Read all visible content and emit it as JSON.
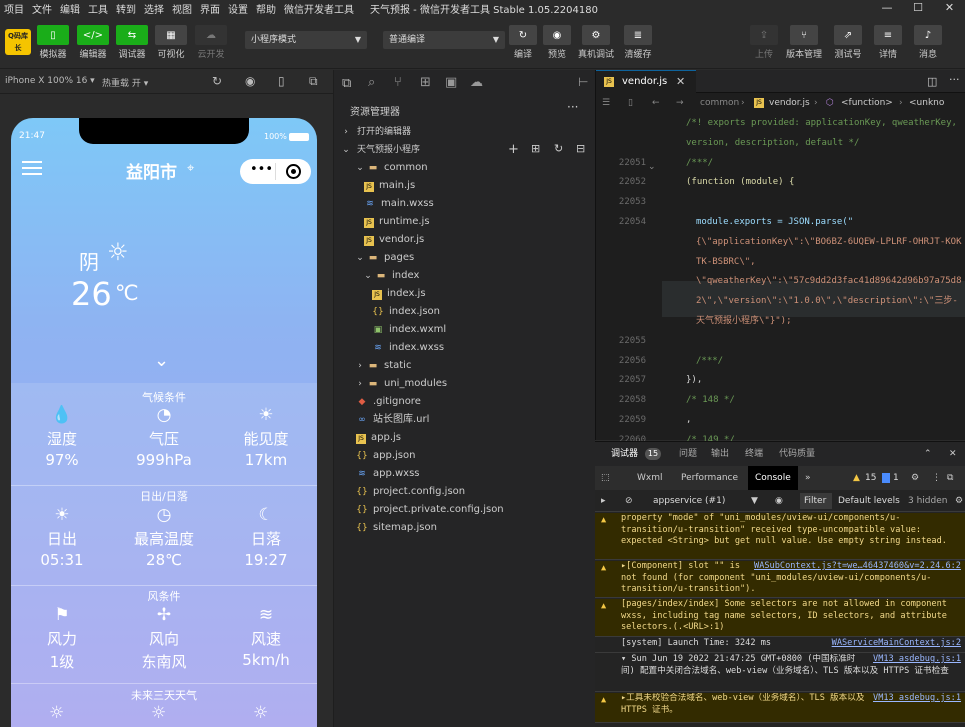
{
  "menubar": {
    "items": [
      "项目",
      "文件",
      "编辑",
      "工具",
      "转到",
      "选择",
      "视图",
      "界面",
      "设置",
      "帮助",
      "微信开发者工具"
    ],
    "title": "天气预报 - 微信开发者工具 Stable 1.05.2204180"
  },
  "toolbar": {
    "logo": "Q码库长",
    "simulator_label": "模拟器",
    "editor_label": "编辑器",
    "debugger_label": "调试器",
    "visual_label": "可视化",
    "cloud_label": "云开发",
    "mode_select": "小程序模式",
    "compile_select": "普通编译",
    "compile_label": "编译",
    "preview_label": "预览",
    "realdebug_label": "真机调试",
    "clearcache_label": "清缓存",
    "upload_label": "上传",
    "version_label": "版本管理",
    "testnum_label": "测试号",
    "detail_label": "详情",
    "message_label": "消息"
  },
  "devbar": {
    "device": "iPhone X 100% 16 ▾",
    "hotreload": "热重载 开 ▾"
  },
  "phone": {
    "time": "21:47",
    "battery": "100%",
    "city": "益阳市",
    "weather": "阴",
    "temp": "26",
    "unit": "℃",
    "sections": [
      {
        "title": "气候条件",
        "cells": [
          {
            "icon": "humidity-icon",
            "glyph": "💧",
            "label": "湿度",
            "value": "97%"
          },
          {
            "icon": "pressure-icon",
            "glyph": "◔",
            "label": "气压",
            "value": "999hPa"
          },
          {
            "icon": "visibility-icon",
            "glyph": "☀",
            "label": "能见度",
            "value": "17km"
          }
        ]
      },
      {
        "title": "日出/日落",
        "cells": [
          {
            "icon": "sunrise-icon",
            "glyph": "☀",
            "label": "日出",
            "value": "05:31"
          },
          {
            "icon": "clock-icon",
            "glyph": "◷",
            "label": "最高温度",
            "value": "28℃"
          },
          {
            "icon": "moon-icon",
            "glyph": "☾",
            "label": "日落",
            "value": "19:27"
          }
        ]
      },
      {
        "title": "风条件",
        "cells": [
          {
            "icon": "flag-icon",
            "glyph": "⚑",
            "label": "风力",
            "value": "1级"
          },
          {
            "icon": "windmill-icon",
            "glyph": "✢",
            "label": "风向",
            "value": "东南风"
          },
          {
            "icon": "wind-icon",
            "glyph": "≋",
            "label": "风速",
            "value": "5km/h"
          }
        ]
      }
    ],
    "forecast_title": "未来三天天气"
  },
  "explorer": {
    "title": "资源管理器",
    "open_editors": "打开的编辑器",
    "project": "天气预报小程序",
    "tree": [
      {
        "name": "common",
        "type": "folder",
        "depth": 1,
        "open": true
      },
      {
        "name": "main.js",
        "type": "js",
        "depth": 2
      },
      {
        "name": "main.wxss",
        "type": "wxss",
        "depth": 2
      },
      {
        "name": "runtime.js",
        "type": "js",
        "depth": 2
      },
      {
        "name": "vendor.js",
        "type": "js",
        "depth": 2
      },
      {
        "name": "pages",
        "type": "folder",
        "depth": 1,
        "open": true
      },
      {
        "name": "index",
        "type": "folder",
        "depth": 2,
        "open": true
      },
      {
        "name": "index.js",
        "type": "js",
        "depth": 3
      },
      {
        "name": "index.json",
        "type": "json",
        "depth": 3
      },
      {
        "name": "index.wxml",
        "type": "wxml",
        "depth": 3
      },
      {
        "name": "index.wxss",
        "type": "wxss",
        "depth": 3
      },
      {
        "name": "static",
        "type": "folder",
        "depth": 1,
        "open": false
      },
      {
        "name": "uni_modules",
        "type": "folder",
        "depth": 1,
        "open": false
      },
      {
        "name": ".gitignore",
        "type": "git",
        "depth": 1
      },
      {
        "name": "站长图库.url",
        "type": "url",
        "depth": 1
      },
      {
        "name": "app.js",
        "type": "js",
        "depth": 1
      },
      {
        "name": "app.json",
        "type": "json",
        "depth": 1
      },
      {
        "name": "app.wxss",
        "type": "wxss",
        "depth": 1
      },
      {
        "name": "project.config.json",
        "type": "json",
        "depth": 1
      },
      {
        "name": "project.private.config.json",
        "type": "json",
        "depth": 1
      },
      {
        "name": "sitemap.json",
        "type": "json",
        "depth": 1
      }
    ]
  },
  "editor": {
    "tab": "vendor.js",
    "breadcrumb": [
      "common",
      "vendor.js",
      "<function>",
      "<unkno"
    ],
    "lines": [
      {
        "n": "",
        "t": "/*! exports provided: applicationKey, qweatherKey,"
      },
      {
        "n": "",
        "t": "version, description, default */"
      },
      {
        "n": "22051",
        "t": "/***/"
      },
      {
        "n": "22052",
        "t": "(function (module) {"
      },
      {
        "n": "22053",
        "t": ""
      },
      {
        "n": "22054",
        "t": "module.exports = JSON.parse(\""
      },
      {
        "n": "",
        "t": "{\\\"applicationKey\\\":\\\"BO6BZ-6UQEW-LPLRF-OHRJT-KOK"
      },
      {
        "n": "",
        "t": "TK-BSBRC\\\","
      },
      {
        "n": "",
        "t": "\\\"qweatherKey\\\":\\\"57c9dd2d3fac41d89642d96b97a75d8"
      },
      {
        "n": "",
        "t": "2\\\",\\\"version\\\":\\\"1.0.0\\\",\\\"description\\\":\\\"三步-"
      },
      {
        "n": "",
        "t": "天气预报小程序\\\"}\");"
      },
      {
        "n": "22055",
        "t": ""
      },
      {
        "n": "22056",
        "t": "/***/"
      },
      {
        "n": "22057",
        "t": "}),"
      },
      {
        "n": "22058",
        "t": "/* 148 */"
      },
      {
        "n": "22059",
        "t": ","
      },
      {
        "n": "22060",
        "t": "/* 149 */"
      }
    ]
  },
  "console": {
    "tabs": [
      "调试器",
      "问题",
      "输出",
      "终端",
      "代码质量"
    ],
    "badge": "15",
    "subtabs": [
      "Wxml",
      "Performance",
      "Console"
    ],
    "warn_count": "15",
    "info_count": "1",
    "context": "appservice (#1)",
    "filter": "Filter",
    "levels": "Default levels",
    "hidden": "3 hidden",
    "messages": [
      {
        "kind": "warn",
        "text": "property \"mode\" of \"uni_modules/uview-ui/components/u-transition/u-transition\" received type-uncompatible value: expected <String> but get null value. Use empty string instead.",
        "link": ""
      },
      {
        "kind": "warn",
        "text": "▸[Component] slot \"\" is not found (for component \"uni_modules/uview-ui/components/u-transition/u-transition\").",
        "link": "WASubContext.js?t=we…46437460&v=2.24.6:2"
      },
      {
        "kind": "warn",
        "text": "[pages/index/index] Some selectors are not allowed in component wxss, including tag name selectors, ID selectors, and attribute selectors.(.<URL>:1)",
        "link": ""
      },
      {
        "kind": "info",
        "text": "[system] Launch Time: 3242 ms",
        "link": "WAServiceMainContext.js:2"
      },
      {
        "kind": "info",
        "text": "▾ Sun Jun 19 2022 21:47:25 GMT+0800 (中国标准时间) 配置中关闭合法域名、web-view（业务域名）、TLS 版本以及 HTTPS 证书检查",
        "link": "VM13 asdebug.js:1"
      },
      {
        "kind": "warn",
        "text": "▸工具未校验合法域名、web-view（业务域名）、TLS 版本以及 HTTPS 证书。",
        "link": "VM13 asdebug.js:1"
      }
    ]
  }
}
